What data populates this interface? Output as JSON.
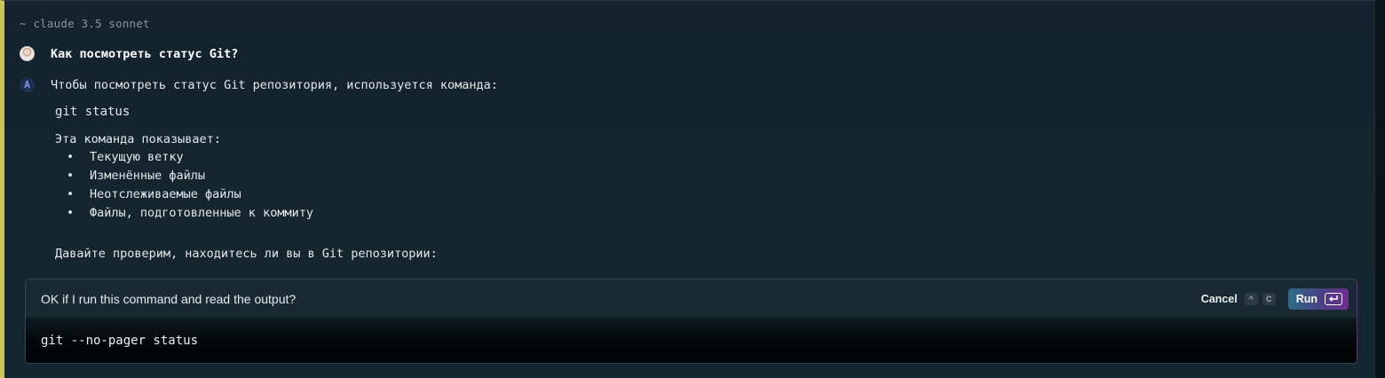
{
  "chat": {
    "model_label": "~ claude 3.5 sonnet",
    "user_question": "Как посмотреть статус Git?",
    "assistant": {
      "intro": "Чтобы посмотреть статус Git репозитория, используется команда:",
      "command": "git status",
      "shows_label": "Эта команда показывает:",
      "bullets": [
        "Текущую ветку",
        "Изменённые файлы",
        "Неотслеживаемые файлы",
        "Файлы, подготовленные к коммиту"
      ],
      "followup": "Давайте проверим, находитесь ли вы в Git репозитории:"
    }
  },
  "prompt": {
    "question": "OK if I run this command and read the output?",
    "cancel_label": "Cancel",
    "cancel_keys": [
      "^",
      "C"
    ],
    "run_label": "Run",
    "run_icon": "enter-key-icon",
    "command": "git --no-pager status"
  },
  "colors": {
    "background": "#14232d",
    "accent_left_border": "#c9c55b",
    "run_gradient_start": "#2c6d86",
    "run_gradient_end": "#6e2d92"
  }
}
